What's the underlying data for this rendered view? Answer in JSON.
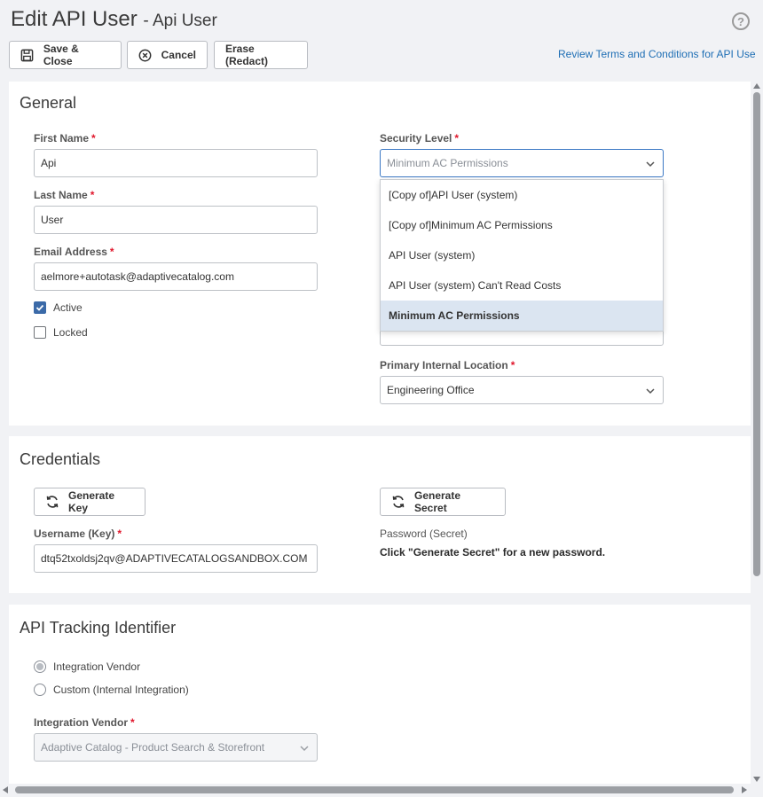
{
  "header": {
    "title": "Edit API User",
    "subtitle": "- Api User",
    "help_icon": "question-circle-icon"
  },
  "toolbar": {
    "save_close_label": "Save & Close",
    "cancel_label": "Cancel",
    "erase_label": "Erase (Redact)",
    "review_link": "Review Terms and Conditions for API Use"
  },
  "general": {
    "title": "General",
    "first_name": {
      "label": "First Name",
      "value": "Api"
    },
    "last_name": {
      "label": "Last Name",
      "value": "User"
    },
    "email": {
      "label": "Email Address",
      "value": "aelmore+autotask@adaptivecatalog.com"
    },
    "active": {
      "label": "Active",
      "checked": true
    },
    "locked": {
      "label": "Locked",
      "checked": false
    },
    "security_level": {
      "label": "Security Level",
      "value": "Minimum AC Permissions",
      "options": [
        "[Copy of]API User (system)",
        "[Copy of]Minimum AC Permissions",
        "API User (system)",
        "API User (system) Can't Read Costs",
        "Minimum AC Permissions"
      ],
      "selected_index": 4
    },
    "primary_location": {
      "label": "Primary Internal Location",
      "value": "Engineering Office"
    }
  },
  "credentials": {
    "title": "Credentials",
    "generate_key_label": "Generate Key",
    "generate_secret_label": "Generate Secret",
    "username": {
      "label": "Username (Key)",
      "value": "dtq52txoldsj2qv@ADAPTIVECATALOGSANDBOX.COM"
    },
    "password": {
      "label": "Password (Secret)",
      "note": "Click \"Generate Secret\" for a new password."
    }
  },
  "tracking": {
    "title": "API Tracking Identifier",
    "radio_vendor": {
      "label": "Integration Vendor",
      "selected": true
    },
    "radio_custom": {
      "label": "Custom (Internal Integration)",
      "selected": false
    },
    "vendor": {
      "label": "Integration Vendor",
      "value": "Adaptive Catalog - Product Search & Storefront"
    }
  },
  "colors": {
    "accent": "#3b6aa8",
    "link": "#1f6fb5",
    "required": "#e0162b",
    "selected_row": "#dbe5f1"
  }
}
